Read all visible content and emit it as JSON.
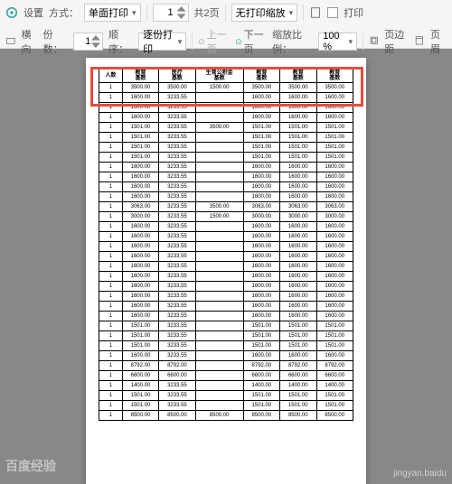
{
  "toolbar": {
    "settings_label": "设置",
    "mode_label": "方式：",
    "mode_value": "单面打印",
    "orient_label": "横向",
    "copies_label": "份数：",
    "copies_value": "1",
    "order_label": "顺序：",
    "order_value": "逐份打印",
    "page_spin": "1",
    "page_total": "共2页",
    "scale_mode": "无打印缩放",
    "prev_label": "上一页",
    "next_label": "下一页",
    "zoom_label": "缩放比例：",
    "zoom_value": "100 %",
    "print_label": "打印",
    "margin_label": "页边距",
    "header_label": "页眉"
  },
  "table": {
    "headers": [
      "人数",
      "教育\n基数",
      "医疗\n基数",
      "生育公积金\n基数",
      "教育\n基数",
      "教育\n基数",
      "教育\n基数"
    ],
    "rows": [
      [
        "1",
        "3500.00",
        "3500.00",
        "1500.00",
        "3500.00",
        "3500.00",
        "3500.00"
      ],
      [
        "1",
        "1600.00",
        "3233.55",
        "",
        "1600.00",
        "1600.00",
        "1600.00"
      ],
      [
        "1",
        "1600.00",
        "3233.55",
        "",
        "1600.00",
        "1600.00",
        "1600.00"
      ],
      [
        "1",
        "1600.00",
        "3233.55",
        "",
        "1600.00",
        "1600.00",
        "1600.00"
      ],
      [
        "1",
        "1501.00",
        "3233.55",
        "3500.00",
        "1501.00",
        "1501.00",
        "1501.00"
      ],
      [
        "1",
        "1501.00",
        "3233.55",
        "",
        "1501.00",
        "1501.00",
        "1501.00"
      ],
      [
        "1",
        "1501.00",
        "3233.55",
        "",
        "1501.00",
        "1501.00",
        "1501.00"
      ],
      [
        "1",
        "1501.00",
        "3233.55",
        "",
        "1501.00",
        "1501.00",
        "1501.00"
      ],
      [
        "1",
        "1600.00",
        "3233.55",
        "",
        "1600.00",
        "1600.00",
        "1600.00"
      ],
      [
        "1",
        "1600.00",
        "3233.55",
        "",
        "1600.00",
        "1600.00",
        "1600.00"
      ],
      [
        "1",
        "1600.00",
        "3233.55",
        "",
        "1600.00",
        "1600.00",
        "1600.00"
      ],
      [
        "1",
        "1600.00",
        "3233.55",
        "",
        "1600.00",
        "1600.00",
        "1600.00"
      ],
      [
        "1",
        "3063.00",
        "3233.55",
        "3500.00",
        "3063.00",
        "3063.00",
        "3063.00"
      ],
      [
        "1",
        "3000.00",
        "3233.55",
        "1500.00",
        "3000.00",
        "3000.00",
        "3000.00"
      ],
      [
        "1",
        "1600.00",
        "3233.55",
        "",
        "1600.00",
        "1600.00",
        "1600.00"
      ],
      [
        "1",
        "1600.00",
        "3233.55",
        "",
        "1600.00",
        "1600.00",
        "1600.00"
      ],
      [
        "1",
        "1600.00",
        "3233.55",
        "",
        "1600.00",
        "1600.00",
        "1600.00"
      ],
      [
        "1",
        "1600.00",
        "3233.55",
        "",
        "1600.00",
        "1600.00",
        "1600.00"
      ],
      [
        "1",
        "1600.00",
        "3233.55",
        "",
        "1600.00",
        "1600.00",
        "1600.00"
      ],
      [
        "1",
        "1600.00",
        "3233.55",
        "",
        "1600.00",
        "1600.00",
        "1600.00"
      ],
      [
        "1",
        "1600.00",
        "3233.55",
        "",
        "1600.00",
        "1600.00",
        "1600.00"
      ],
      [
        "1",
        "1600.00",
        "3233.55",
        "",
        "1600.00",
        "1600.00",
        "1600.00"
      ],
      [
        "1",
        "1600.00",
        "3233.55",
        "",
        "1600.00",
        "1600.00",
        "1600.00"
      ],
      [
        "1",
        "1600.00",
        "3233.55",
        "",
        "1600.00",
        "1600.00",
        "1600.00"
      ],
      [
        "1",
        "1501.00",
        "3233.55",
        "",
        "1501.00",
        "1501.00",
        "1501.00"
      ],
      [
        "1",
        "1501.00",
        "3233.55",
        "",
        "1501.00",
        "1501.00",
        "1501.00"
      ],
      [
        "1",
        "1501.00",
        "3233.55",
        "",
        "1501.00",
        "1501.00",
        "1501.00"
      ],
      [
        "1",
        "1600.00",
        "3233.55",
        "",
        "1600.00",
        "1600.00",
        "1600.00"
      ],
      [
        "1",
        "8792.00",
        "8792.00",
        "",
        "8792.00",
        "8792.00",
        "8792.00"
      ],
      [
        "1",
        "6600.00",
        "6600.00",
        "",
        "6600.00",
        "6600.00",
        "6600.00"
      ],
      [
        "1",
        "1400.00",
        "3233.55",
        "",
        "1400.00",
        "1400.00",
        "1400.00"
      ],
      [
        "1",
        "1501.00",
        "3233.55",
        "",
        "1501.00",
        "1501.00",
        "1501.00"
      ],
      [
        "1",
        "1501.00",
        "3233.55",
        "",
        "1501.00",
        "1501.00",
        "1501.00"
      ],
      [
        "1",
        "8500.00",
        "8500.00",
        "8500.00",
        "8500.00",
        "8500.00",
        "8500.00"
      ]
    ]
  },
  "watermark": {
    "site": "百度经验",
    "user": "jingyan.baidu"
  }
}
